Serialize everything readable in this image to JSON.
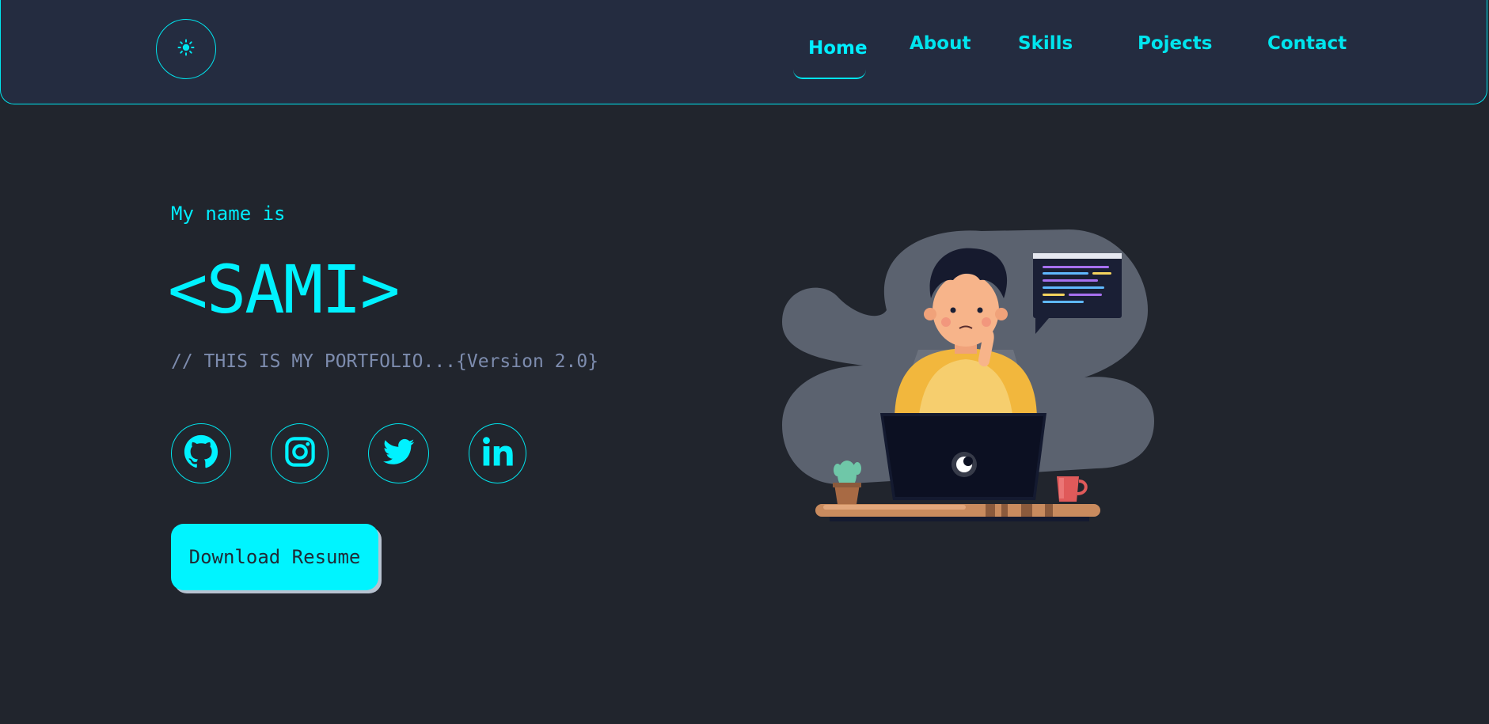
{
  "nav": {
    "theme_icon": "sun-icon",
    "items": [
      {
        "label": "Home",
        "active": true
      },
      {
        "label": "About"
      },
      {
        "label": "Skills"
      },
      {
        "label": "Pojects"
      },
      {
        "label": "Contact"
      }
    ]
  },
  "hero": {
    "greeting": "My name is",
    "name": "<SAMI>",
    "tagline": "// THIS IS MY PORTFOLIO...{Version 2.0}",
    "socials": [
      {
        "icon": "github-icon"
      },
      {
        "icon": "instagram-icon"
      },
      {
        "icon": "twitter-icon"
      },
      {
        "icon": "linkedin-icon"
      }
    ],
    "download_label": "Download Resume"
  },
  "colors": {
    "accent": "#00f2ff",
    "background": "#21252d",
    "navbar": "#242c40",
    "tagline": "#7d8cae"
  }
}
